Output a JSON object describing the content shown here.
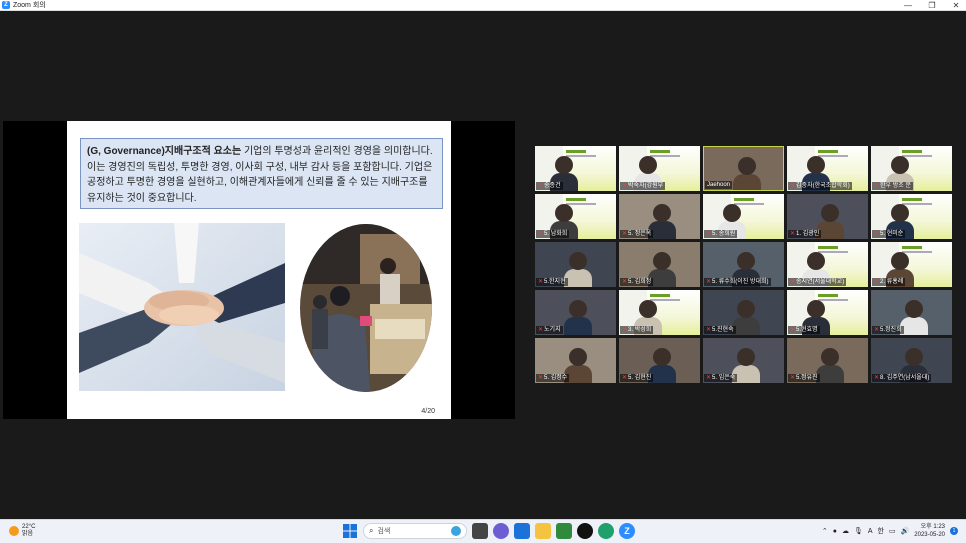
{
  "window": {
    "title": "Zoom 회의",
    "app_icon": "zoom-icon",
    "controls": [
      "—",
      "❐",
      "✕"
    ]
  },
  "slide": {
    "text_bold": "(G, Governance)지배구조적 요소는",
    "text_rest": " 기업의 투명성과 윤리적인 경영을 의미합니다. 이는 경영진의 독립성, 투명한 경영, 이사회 구성, 내부 감사 등을 포함합니다. 기업은 공정하고 투명한 경영을 실현하고, 이해관계자들에게 신뢰를 줄 수 있는 지배구조를 유지하는 것이 중요합니다.",
    "page": "4/20",
    "box_bg": "#dbe5f4"
  },
  "gallery": [
    {
      "name": "송종건",
      "muted": true,
      "kind": "banner"
    },
    {
      "name": "박숙자(강원부",
      "muted": true,
      "kind": "banner"
    },
    {
      "name": "Jaehoon",
      "muted": false,
      "kind": "active"
    },
    {
      "name": "김중자(한국조합학회)",
      "muted": true,
      "kind": "banner"
    },
    {
      "name": "한우 방조 문",
      "muted": true,
      "kind": "banner"
    },
    {
      "name": "5. 남화희",
      "muted": true,
      "kind": "banner"
    },
    {
      "name": "5. 정은옥",
      "muted": true,
      "kind": "cam"
    },
    {
      "name": "5. 송희원",
      "muted": true,
      "kind": "banner"
    },
    {
      "name": "1. 김광인",
      "muted": true,
      "kind": "cam"
    },
    {
      "name": "5. 현미순",
      "muted": true,
      "kind": "banner"
    },
    {
      "name": "5.한지현",
      "muted": true,
      "kind": "cam"
    },
    {
      "name": "5. 김희정",
      "muted": true,
      "kind": "cam"
    },
    {
      "name": "5. 류수희(이진 방대희)",
      "muted": true,
      "kind": "cam"
    },
    {
      "name": "송지연(서울대학교)",
      "muted": true,
      "kind": "banner"
    },
    {
      "name": "2. 류홍례",
      "muted": true,
      "kind": "banner"
    },
    {
      "name": "노기지",
      "muted": true,
      "kind": "cam"
    },
    {
      "name": "3. 박성희",
      "muted": true,
      "kind": "banner"
    },
    {
      "name": "5.진현숙",
      "muted": true,
      "kind": "cam"
    },
    {
      "name": "5.현효명",
      "muted": true,
      "kind": "banner"
    },
    {
      "name": "5.정진희",
      "muted": true,
      "kind": "cam"
    },
    {
      "name": "5. 김정수",
      "muted": true,
      "kind": "cam"
    },
    {
      "name": "5. 김현진",
      "muted": true,
      "kind": "cam"
    },
    {
      "name": "5. 임은숙",
      "muted": true,
      "kind": "cam"
    },
    {
      "name": "5.정유진",
      "muted": true,
      "kind": "cam"
    },
    {
      "name": "8. 김주연(남서울대)",
      "muted": true,
      "kind": "cam"
    }
  ],
  "taskbar": {
    "weather_temp": "22°C",
    "weather_desc": "맑음",
    "search_placeholder": "검색",
    "tray_lang": "A",
    "tray_ime": "한",
    "clock_time": "오후 1:23",
    "clock_date": "2023-05-20",
    "notif_count": "1"
  }
}
